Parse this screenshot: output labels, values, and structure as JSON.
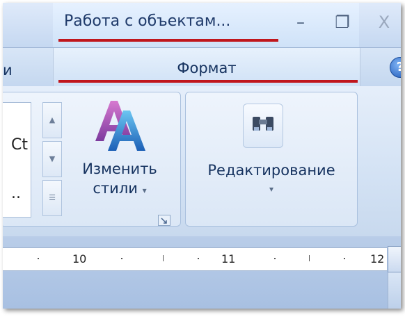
{
  "title_bar": {
    "context_title": "Работа с объектам...",
    "minimize_glyph": "–",
    "maximize_glyph": "❐",
    "close_glyph": "X"
  },
  "tabs": {
    "left_fragment": "и",
    "format": "Формат",
    "help_glyph": "?"
  },
  "ribbon": {
    "styles_fragment_1": "Сt",
    "styles_fragment_2": "..",
    "change_styles_line1": "Изменить",
    "change_styles_line2": "стили",
    "dropdown_caret": "▾",
    "editing_label": "Редактирование",
    "editing_caret": "▾"
  },
  "ruler": {
    "labels": [
      "10",
      "11",
      "12"
    ]
  },
  "colors": {
    "annotation_red": "#c0161c",
    "accent_blue": "#1f3a6a"
  }
}
